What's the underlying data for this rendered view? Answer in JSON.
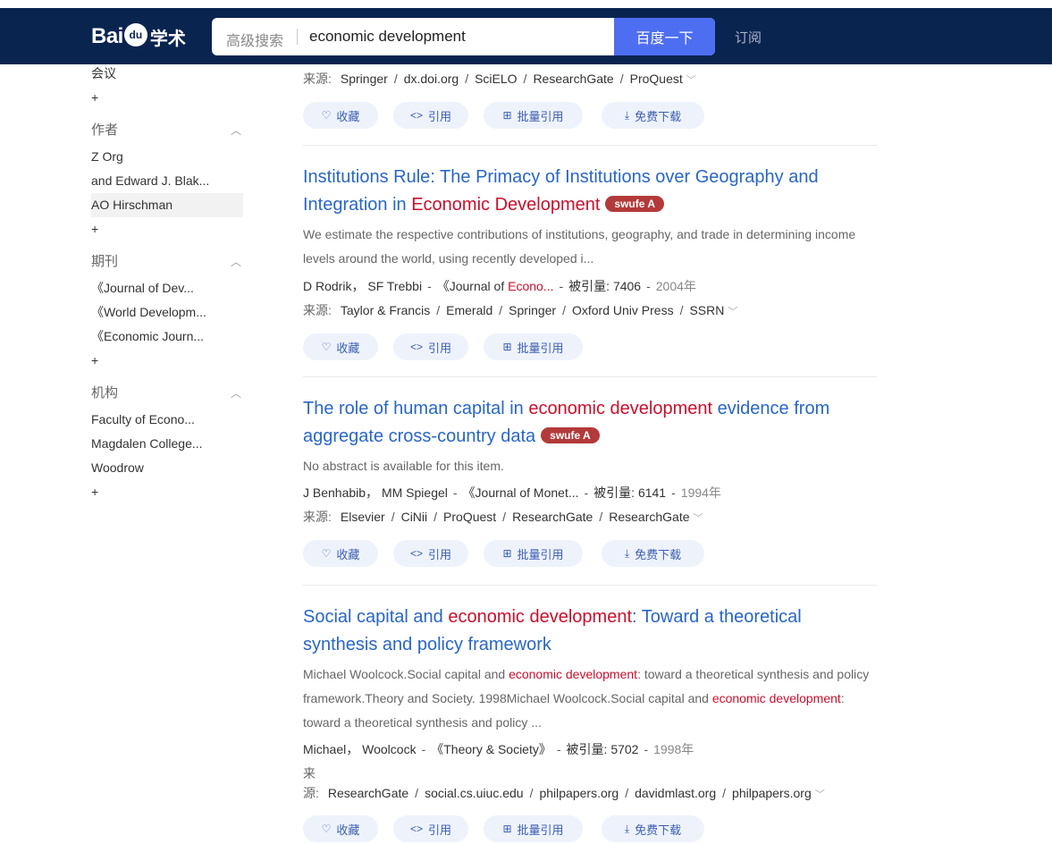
{
  "header": {
    "logo_bai": "Bai",
    "logo_du": "du",
    "logo_xueshu": "学术",
    "advanced_search": "高级搜索",
    "query": "economic development",
    "search_button": "百度一下",
    "subscribe": "订阅"
  },
  "sidebar": {
    "conference_item": "会议",
    "plus": "+",
    "author_heading": "作者",
    "authors": [
      "Z Org",
      "and Edward J. Blak...",
      "AO Hirschman"
    ],
    "journal_heading": "期刊",
    "journals": [
      "《Journal of Dev...",
      "《World Developm...",
      "《Economic Journ..."
    ],
    "institution_heading": "机构",
    "institutions": [
      "Faculty of Econo...",
      "Magdalen College...",
      "Woodrow"
    ]
  },
  "labels": {
    "source_label": "来源:",
    "favorite": "收藏",
    "cite": "引用",
    "batch_cite": "批量引用",
    "free_download": "免费下载",
    "cited_label": "被引量:"
  },
  "result0": {
    "sources": [
      "Springer",
      "dx.doi.org",
      "SciELO",
      "ResearchGate",
      "ProQuest"
    ]
  },
  "result1": {
    "title_a": "Institutions Rule: The Primacy of Institutions over Geography and Integration in ",
    "title_hl": "Economic Development",
    "badge": "swufe A",
    "abstract": "We estimate the respective contributions of institutions, geography, and trade in determining income levels around the world, using recently developed i...",
    "author1": "D Rodrik，",
    "author2": "SF Trebbi",
    "journal_a": "《Journal of ",
    "journal_hl": "Econo...",
    "cited": "7406",
    "year": "2004年",
    "sources": [
      "Taylor & Francis",
      "Emerald",
      "Springer",
      "Oxford Univ Press",
      "SSRN"
    ]
  },
  "result2": {
    "title_a": "The role of human capital in ",
    "title_hl": "economic development",
    "title_b": " evidence from aggregate cross-country data",
    "badge": "swufe A",
    "abstract": "No abstract is available for this item.",
    "author1": "J Benhabib，",
    "author2": "MM Spiegel",
    "journal": "《Journal of Monet...",
    "cited": "6141",
    "year": "1994年",
    "sources": [
      "Elsevier",
      "CiNii",
      "ProQuest",
      "ResearchGate",
      "ResearchGate"
    ]
  },
  "result3": {
    "title_a": "Social capital and ",
    "title_hl": "economic development",
    "title_b": ": Toward a theoretical synthesis and policy framework",
    "abs_1": "Michael Woolcock.Social capital and ",
    "abs_hl1": "economic development",
    "abs_2": ": toward a theoretical synthesis and policy framework.Theory and Society. 1998Michael Woolcock.Social capital and ",
    "abs_hl2": "economic development",
    "abs_3": ": toward a theoretical synthesis and policy ...",
    "author1": "Michael，",
    "author2": "Woolcock",
    "journal": "《Theory & Society》",
    "cited": "5702",
    "year": "1998年",
    "sources": [
      "ResearchGate",
      "social.cs.uiuc.edu",
      "philpapers.org",
      "davidmlast.org",
      "philpapers.org"
    ]
  },
  "colors": {
    "header_bg": "#0a2450",
    "search_button": "#4e6ef2",
    "title_link": "#2a66c4",
    "highlight": "#c8102e",
    "badge": "#b33a3a"
  }
}
